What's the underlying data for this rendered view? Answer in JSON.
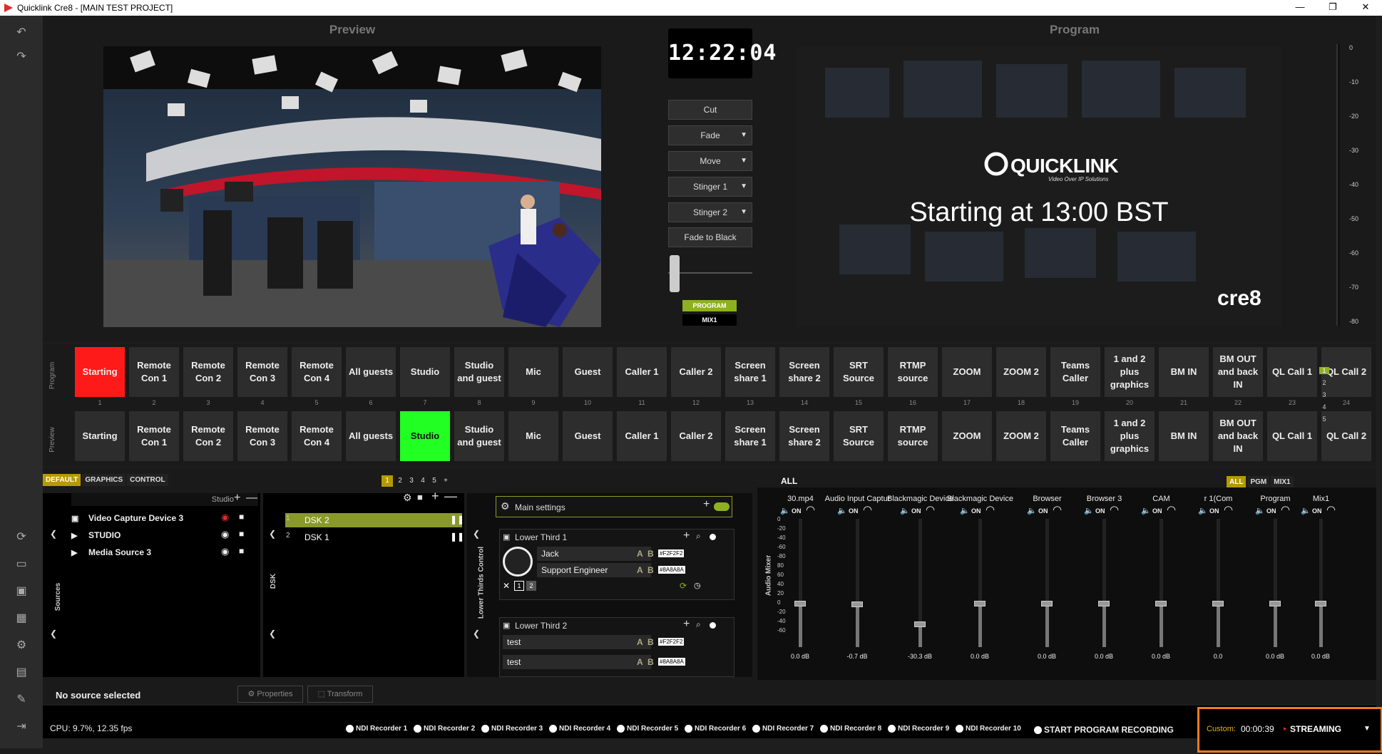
{
  "window": {
    "title": "Quicklink Cre8  - [MAIN TEST PROJECT]",
    "min": "—",
    "max": "❐",
    "close": "✕"
  },
  "preview": {
    "title": "Preview"
  },
  "program": {
    "title": "Program",
    "logo_text": "QUICKLINK",
    "logo_sub": "Video Over IP Solutions",
    "headline": "Starting at 13:00 BST",
    "brand": "cre8"
  },
  "clock": "12:22:04",
  "transitions": {
    "cut": "Cut",
    "fade": "Fade",
    "move": "Move",
    "stinger1": "Stinger 1",
    "stinger2": "Stinger 2",
    "ftb": "Fade to Black",
    "program_label": "PROGRAM",
    "mix": "MIX1"
  },
  "vu_ticks": [
    "0",
    "-10",
    "-20",
    "-30",
    "-40",
    "-50",
    "-60",
    "-70",
    "-80"
  ],
  "row_labels": {
    "program": "Program",
    "preview": "Preview"
  },
  "sources": [
    "Starting",
    "Remote Con 1",
    "Remote Con 2",
    "Remote Con 3",
    "Remote Con 4",
    "All guests",
    "Studio",
    "Studio and guest",
    "Mic",
    "Guest",
    "Caller 1",
    "Caller 2",
    "Screen share 1",
    "Screen share 2",
    "SRT Source",
    "RTMP source",
    "ZOOM",
    "ZOOM 2",
    "Teams Caller",
    "1 and 2 plus graphics",
    "BM IN",
    "BM OUT and back IN",
    "QL Call 1",
    "QL Call 2"
  ],
  "source_numbers": [
    "1",
    "2",
    "3",
    "4",
    "5",
    "6",
    "7",
    "8",
    "9",
    "10",
    "11",
    "12",
    "13",
    "14",
    "15",
    "16",
    "17",
    "18",
    "19",
    "20",
    "21",
    "22",
    "23",
    "24"
  ],
  "pages": [
    "1",
    "2",
    "3",
    "4",
    "5"
  ],
  "bottom_tabs": [
    "DEFAULT",
    "GRAPHICS",
    "CONTROL"
  ],
  "scene": {
    "name": "Studio",
    "items": [
      "Video Capture Device 3",
      "STUDIO",
      "Media Source 3"
    ],
    "label": "Sources"
  },
  "dsk": {
    "pages": [
      "1",
      "2",
      "3",
      "4",
      "5",
      "+"
    ],
    "items": [
      "DSK 2",
      "DSK 1"
    ],
    "label": "DSK",
    "nums": [
      "1",
      "2"
    ]
  },
  "lower_thirds": {
    "label": "Lower Thirds Control",
    "main_settings": "Main settings",
    "lt1": {
      "title": "Lower Third 1",
      "name": "Jack",
      "role": "Support Engineer",
      "hex1": "#F2F2F2",
      "hex2": "#8A8A8A"
    },
    "lt2": {
      "title": "Lower Third 2",
      "name": "test",
      "role": "test",
      "hex1": "#F2F2F2",
      "hex2": "#8A8A8A"
    }
  },
  "mixer": {
    "label": "Audio Mixer",
    "title": "ALL",
    "tabs": [
      "ALL",
      "PGM",
      "MIX1"
    ],
    "channels": [
      {
        "name": "30.mp4",
        "db": "0.0 dB",
        "level": 0.75
      },
      {
        "name": "Audio Input Captur",
        "db": "-0.7 dB",
        "level": 0.74
      },
      {
        "name": "Blackmagic Device",
        "db": "-30.3 dB",
        "level": 0.4
      },
      {
        "name": "Blackmagic Device",
        "db": "0.0 dB",
        "level": 0.75
      },
      {
        "name": "Browser",
        "db": "0.0 dB",
        "level": 0.75
      },
      {
        "name": "Browser 3",
        "db": "0.0 dB",
        "level": 0.75
      },
      {
        "name": "CAM",
        "db": "0.0 dB",
        "level": 0.75
      },
      {
        "name": "r 1(Com",
        "db": "0.0",
        "level": 0.75
      },
      {
        "name": "Program",
        "db": "0.0 dB",
        "level": 0.75
      },
      {
        "name": "Mix1",
        "db": "0.0 dB",
        "level": 0.75
      }
    ],
    "on": "ON",
    "scale": [
      "0",
      "-20",
      "-40",
      "-60",
      "-80",
      "80",
      "60",
      "40",
      "20",
      "0",
      "-20",
      "-40",
      "-60"
    ]
  },
  "footer": {
    "no_source": "No source selected",
    "properties": "Properties",
    "transform": "Transform"
  },
  "status": {
    "cpu": "CPU: 9.7%, 12.35 fps",
    "recorders": [
      "NDI Recorder 1",
      "NDI Recorder 2",
      "NDI Recorder 3",
      "NDI Recorder 4",
      "NDI Recorder 5",
      "NDI Recorder 6",
      "NDI Recorder 7",
      "NDI Recorder 8",
      "NDI Recorder 9",
      "NDI Recorder 10"
    ],
    "start_rec": "START PROGRAM RECORDING",
    "custom": "Custom:",
    "time": "00:00:39",
    "streaming": "STREAMING",
    "colors": {
      "accent": "#b59b00",
      "highlight": "#f47a1c",
      "program_live": "#ff1a1a",
      "preview_live": "#22ff22"
    }
  }
}
